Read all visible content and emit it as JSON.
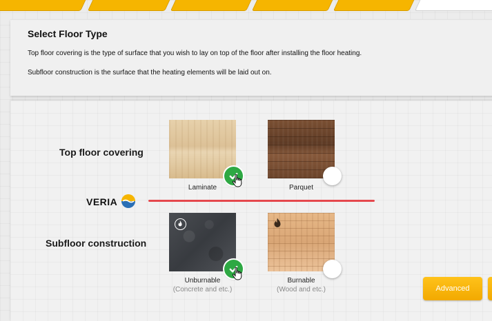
{
  "header": {
    "tabs_count": 6,
    "active_tab_index": 5
  },
  "info": {
    "title": "Select Floor Type",
    "text1": "Top floor covering is the type of surface that you wish to lay on top of the floor after installing the floor heating.",
    "text2": "Subfloor construction is the surface that the heating elements will be laid out on."
  },
  "selection": {
    "top_label": "Top floor covering",
    "sub_label": "Subfloor construction",
    "logo_text": "VERIA",
    "top_options": [
      {
        "label": "Laminate",
        "selected": true
      },
      {
        "label": "Parquet",
        "selected": false
      }
    ],
    "sub_options": [
      {
        "label": "Unburnable",
        "sublabel": "(Concrete and etc.)",
        "selected": true,
        "icon": "fire-circle-icon"
      },
      {
        "label": "Burnable",
        "sublabel": "(Wood and etc.)",
        "selected": false,
        "icon": "flame-icon"
      }
    ]
  },
  "buttons": {
    "advanced": "Advanced"
  },
  "colors": {
    "accent": "#f6b500",
    "divider": "#e5484d",
    "check": "#2ea843",
    "logo_blue": "#2a6fb6"
  }
}
